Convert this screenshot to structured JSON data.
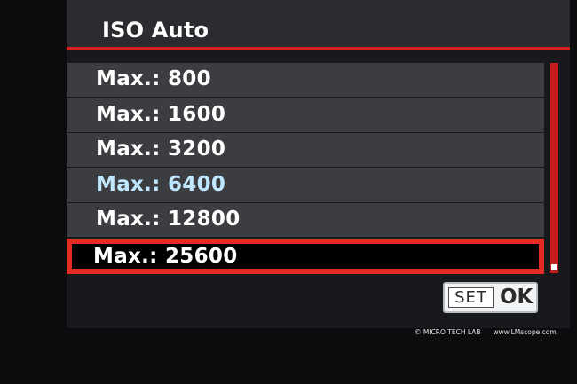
{
  "menu": {
    "title": "ISO Auto",
    "items": [
      {
        "label": "Max.: 800"
      },
      {
        "label": "Max.: 1600"
      },
      {
        "label": "Max.: 3200"
      },
      {
        "label": "Max.: 6400"
      },
      {
        "label": "Max.: 12800"
      },
      {
        "label": "Max.: 25600"
      }
    ],
    "selected_index": 5,
    "current_setting_index": 3
  },
  "controls": {
    "set_label": "SET",
    "ok_label": "OK"
  },
  "watermark": {
    "symbol": "©",
    "brand": "MICRO TECH LAB",
    "url": "www.LMscope.com"
  },
  "colors": {
    "accent_red": "#e52a25",
    "current_value_blue": "#bfe7ff"
  }
}
